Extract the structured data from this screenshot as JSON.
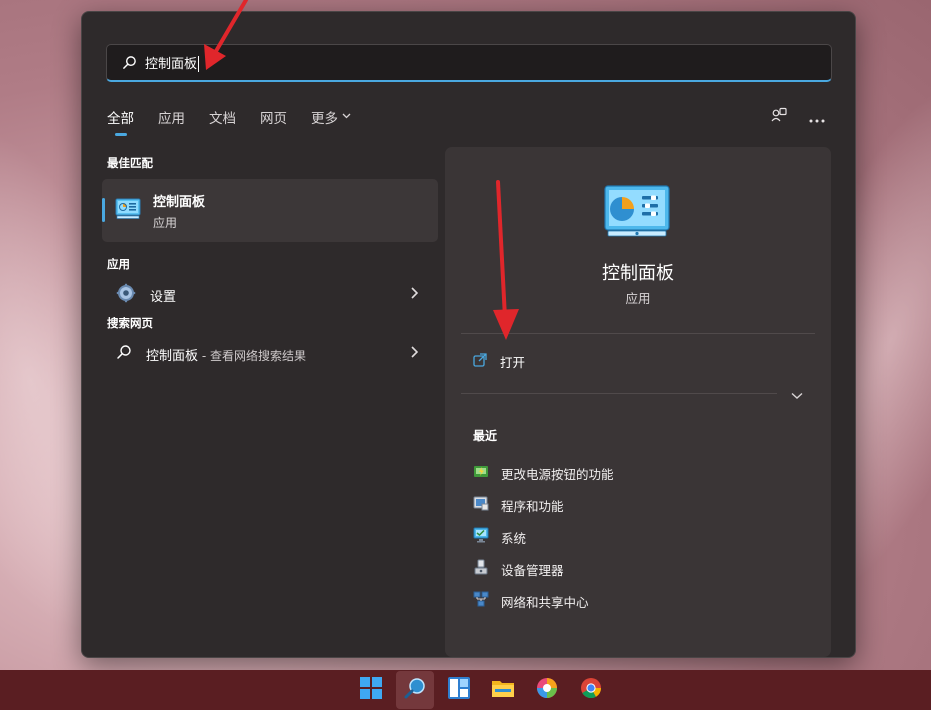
{
  "search": {
    "query": "控制面板"
  },
  "tabs": [
    {
      "label": "全部"
    },
    {
      "label": "应用"
    },
    {
      "label": "文档"
    },
    {
      "label": "网页"
    },
    {
      "label": "更多"
    }
  ],
  "top_icons": [
    "account-switch-icon",
    "more-ellipsis-icon"
  ],
  "left": {
    "best_match_title": "最佳匹配",
    "best_match": {
      "name": "控制面板",
      "type": "应用",
      "icon": "control-panel-icon"
    },
    "apps_title": "应用",
    "apps": [
      {
        "name": "设置",
        "icon": "gear-icon"
      }
    ],
    "web_title": "搜索网页",
    "web": [
      {
        "name": "控制面板",
        "suffix": " - 查看网络搜索结果",
        "icon": "search-icon"
      }
    ]
  },
  "right": {
    "app_name": "控制面板",
    "app_type": "应用",
    "open_label": "打开",
    "recent_title": "最近",
    "recent": [
      {
        "label": "更改电源按钮的功能",
        "icon": "power-options-icon"
      },
      {
        "label": "程序和功能",
        "icon": "programs-icon"
      },
      {
        "label": "系统",
        "icon": "system-icon"
      },
      {
        "label": "设备管理器",
        "icon": "device-manager-icon"
      },
      {
        "label": "网络和共享中心",
        "icon": "network-center-icon"
      }
    ]
  },
  "taskbar": [
    {
      "name": "start-icon"
    },
    {
      "name": "search-icon",
      "active": true
    },
    {
      "name": "widgets-icon"
    },
    {
      "name": "file-explorer-icon"
    },
    {
      "name": "photos-app-icon"
    },
    {
      "name": "chrome-icon"
    }
  ],
  "colors": {
    "accent": "#4aa8e0",
    "panel": "#2e2a2b",
    "detail": "#3a3536",
    "taskbar": "#5a1e22",
    "annotation": "#e0262b"
  }
}
